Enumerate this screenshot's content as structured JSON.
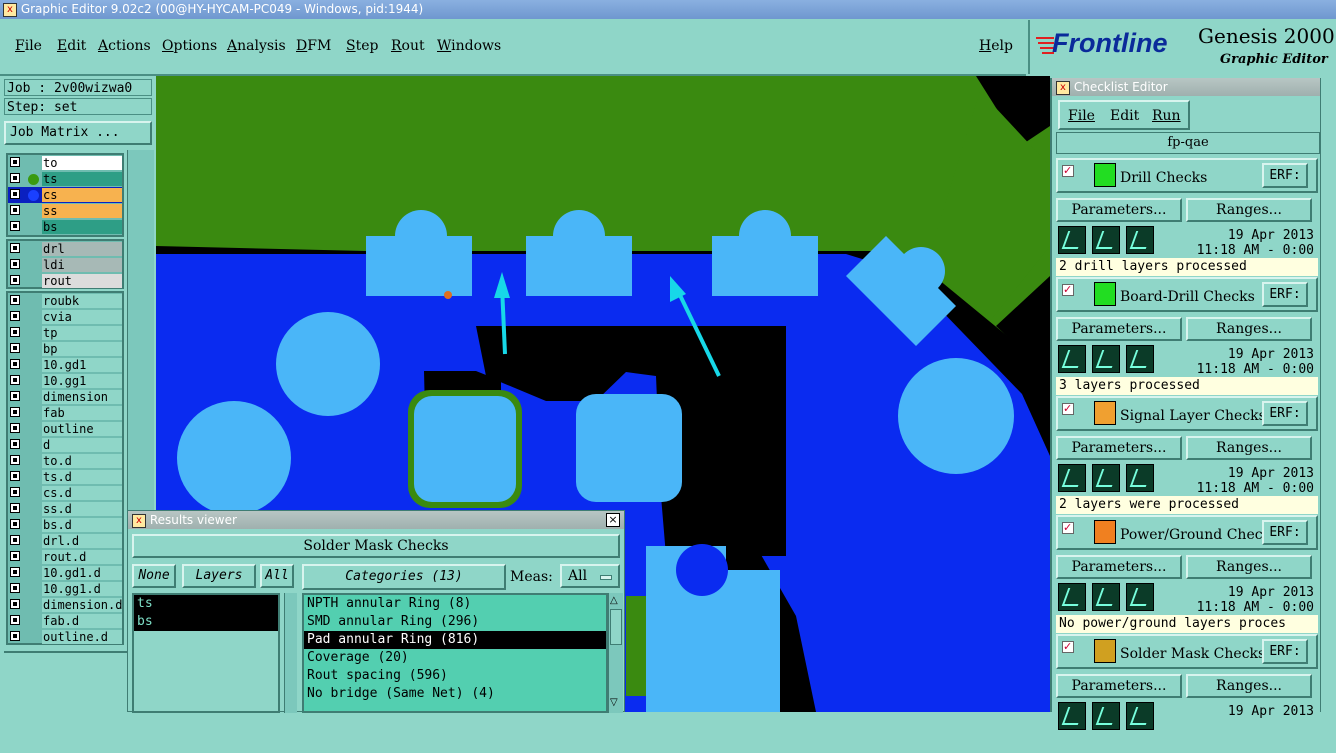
{
  "window": {
    "title": "Graphic Editor 9.02c2 (00@HY-HYCAM-PC049 - Windows, pid:1944)"
  },
  "menu": [
    "File",
    "Edit",
    "Actions",
    "Options",
    "Analysis",
    "DFM",
    "Step",
    "Rout",
    "Windows"
  ],
  "help_label": "Help",
  "brand": {
    "logo": "Frontline",
    "product": "Genesis 2000",
    "subtitle": "Graphic Editor"
  },
  "job": {
    "job_label": "Job : 2v00wizwa0",
    "step_label": "Step: set",
    "matrix_button": "Job Matrix ..."
  },
  "layers": {
    "signal": [
      {
        "name": "to",
        "color": "#ffffff"
      },
      {
        "name": "ts",
        "color": "#2e9e86"
      },
      {
        "name": "cs",
        "color": "#f7b24f"
      },
      {
        "name": "ss",
        "color": "#f7b24f"
      },
      {
        "name": "bs",
        "color": "#2e9e86"
      }
    ],
    "drill": [
      {
        "name": "drl",
        "color": "#a7b9b6"
      },
      {
        "name": "ldi",
        "color": "#a7b9b6"
      },
      {
        "name": "rout",
        "color": "#dcdcdc"
      }
    ],
    "misc": [
      "roubk",
      "cvia",
      "tp",
      "bp",
      "10.gd1",
      "10.gg1",
      "dimension",
      "fab",
      "outline",
      "d",
      "to.d",
      "ts.d",
      "cs.d",
      "ss.d",
      "bs.d",
      "drl.d",
      "rout.d",
      "10.gd1.d",
      "10.gg1.d",
      "dimension.d",
      "fab.d",
      "outline.d"
    ]
  },
  "results_viewer": {
    "title": "Results viewer",
    "header": "Solder Mask Checks",
    "none_button": "None",
    "layers_button": "Layers",
    "all_button": "All",
    "categories_button": "Categories (13)",
    "meas_label": "Meas:",
    "meas_value": "All",
    "layers_list": [
      "ts",
      "bs"
    ],
    "categories": [
      {
        "label": "NPTH annular Ring (8)",
        "selected": false
      },
      {
        "label": "SMD annular Ring (296)",
        "selected": false
      },
      {
        "label": "Pad annular Ring (816)",
        "selected": true
      },
      {
        "label": "Coverage (20)",
        "selected": false
      },
      {
        "label": "Rout spacing (596)",
        "selected": false
      },
      {
        "label": "No bridge (Same Net) (4)",
        "selected": false
      }
    ]
  },
  "checklist_editor": {
    "title": "Checklist Editor",
    "menu": [
      "File",
      "Edit",
      "Run"
    ],
    "checklist_name": "fp-qae",
    "erf_label": "ERF:",
    "parameters_label": "Parameters...",
    "ranges_label": "Ranges...",
    "checks": [
      {
        "name": "Drill Checks",
        "date": "19 Apr 2013",
        "time": "11:18 AM - 0:00",
        "status": "2 drill layers processed",
        "icon_color": "#22dd22"
      },
      {
        "name": "Board-Drill Checks",
        "date": "19 Apr 2013",
        "time": "11:18 AM - 0:00",
        "status": "3 layers processed",
        "icon_color": "#22dd22"
      },
      {
        "name": "Signal Layer Checks",
        "date": "19 Apr 2013",
        "time": "11:18 AM - 0:00",
        "status": "2 layers were processed",
        "icon_color": "#f0a030"
      },
      {
        "name": "Power/Ground Checks",
        "date": "19 Apr 2013",
        "time": "11:18 AM - 0:00",
        "status": "No power/ground layers proces",
        "icon_color": "#f08020"
      },
      {
        "name": "Solder Mask Checks",
        "date": "19 Apr 2013",
        "time": "",
        "status": "",
        "icon_color": "#d0a020"
      }
    ]
  },
  "colors": {
    "panel": "#8fd6c8",
    "board_green": "#3a8a10",
    "copper_blue": "#0a2bf0",
    "pad_blue": "#4ab6f8",
    "arrow": "#17d8e8"
  }
}
